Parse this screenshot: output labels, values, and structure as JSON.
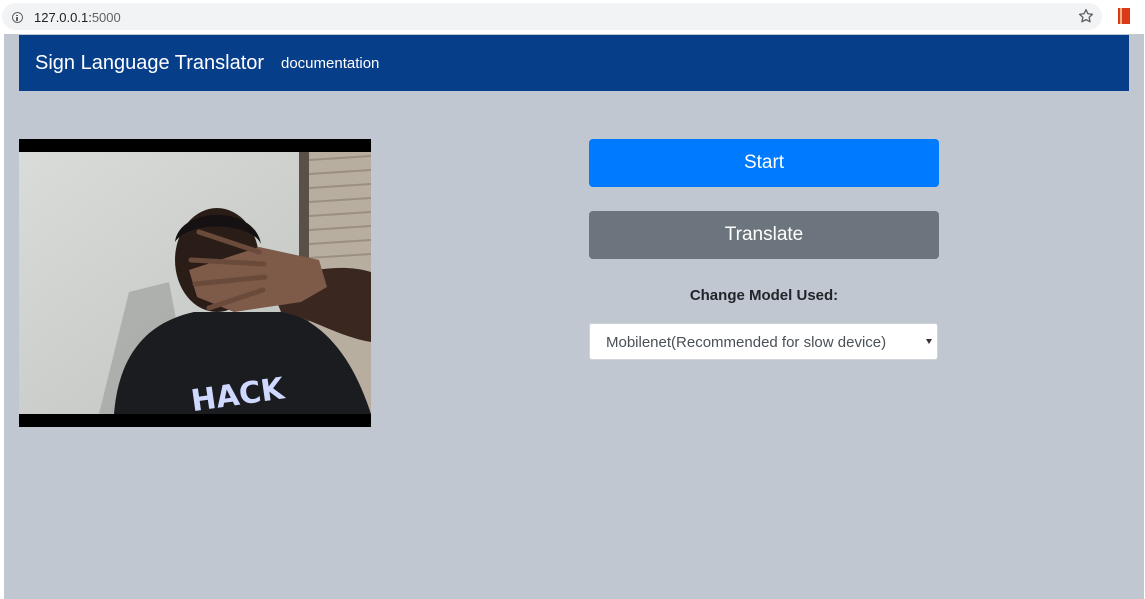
{
  "browser": {
    "url_host": "127.0.0.1:",
    "url_port": "5000",
    "star_icon": "star-outline-icon",
    "extension_icon": "bookmark-extension-icon"
  },
  "navbar": {
    "brand": "Sign Language Translator",
    "link": "documentation",
    "background": "#073e8a"
  },
  "video": {
    "shirt_text": "HACK"
  },
  "controls": {
    "start_label": "Start",
    "translate_label": "Translate",
    "model_label": "Change Model Used:",
    "model_selected": "Mobilenet(Recommended for slow device)",
    "start_color": "#007bff",
    "translate_color": "#6c757d"
  }
}
